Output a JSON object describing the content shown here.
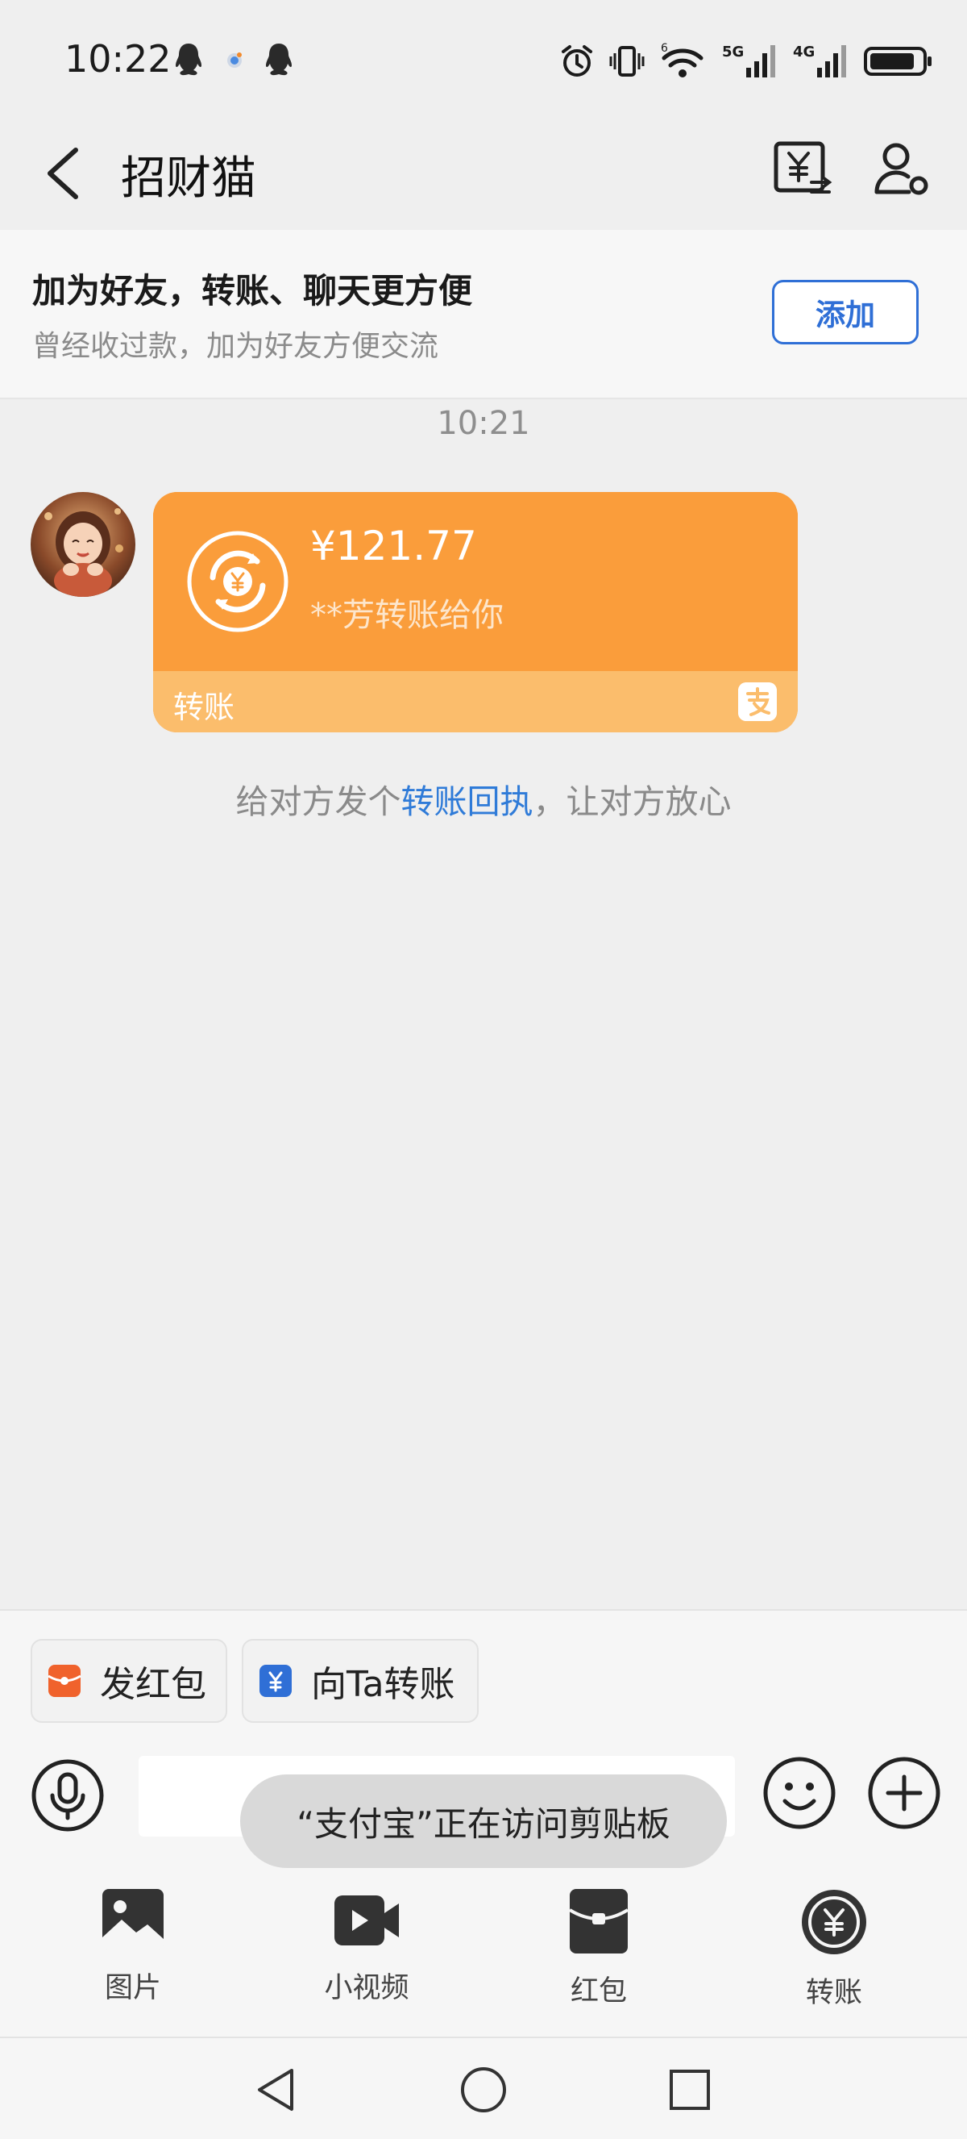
{
  "status_bar": {
    "time": "10:22",
    "icons": [
      "qq-icon",
      "notification-icon",
      "qq-icon",
      "alarm-icon",
      "vibrate-icon",
      "wifi-icon",
      "signal-5g-icon",
      "signal-4g-icon",
      "battery-icon"
    ],
    "network_5g": "5G",
    "network_4g": "4G",
    "wifi_badge": "6"
  },
  "header": {
    "title": "招财猫",
    "icons": [
      "back-icon",
      "yuan-transfer-icon",
      "contact-settings-icon"
    ]
  },
  "add_friend_banner": {
    "title": "加为好友，转账、聊天更方便",
    "subtitle": "曾经收过款，加为好友方便交流",
    "button": "添加"
  },
  "chat": {
    "timestamp": "10:21",
    "transfer_message": {
      "amount": "¥121.77",
      "description": "**芳转账给你",
      "label": "转账",
      "icon": "yuan-cycle-icon",
      "badge_icon": "alipay-icon",
      "colors": {
        "card": "#fa9d3b",
        "footer": "#fbbd6c"
      }
    },
    "receipt_tip": {
      "prefix": "给对方发个",
      "link": "转账回执",
      "suffix": "，让对方放心"
    }
  },
  "quick_actions": [
    {
      "label": "发红包",
      "icon": "red-packet-icon",
      "color": "#f0622c"
    },
    {
      "label": "向Ta转账",
      "icon": "yuan-transfer-icon",
      "color": "#2f6fd6"
    }
  ],
  "input_bar": {
    "icons": [
      "microphone-icon",
      "emoji-icon",
      "plus-icon"
    ],
    "value": ""
  },
  "toast": "“支付宝”正在访问剪贴板",
  "tools": [
    {
      "label": "图片",
      "icon": "image-icon"
    },
    {
      "label": "小视频",
      "icon": "video-icon"
    },
    {
      "label": "红包",
      "icon": "red-packet-icon"
    },
    {
      "label": "转账",
      "icon": "yuan-transfer-icon"
    }
  ],
  "nav_bar": {
    "icons": [
      "nav-back-icon",
      "nav-home-icon",
      "nav-recents-icon"
    ]
  }
}
